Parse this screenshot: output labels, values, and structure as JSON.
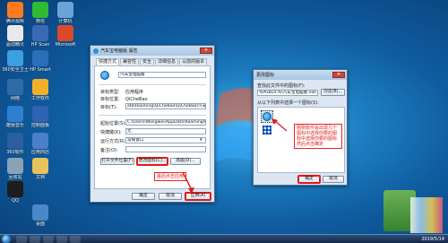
{
  "desktop_icons": [
    {
      "label": "腾讯视频",
      "color": "#ff7a1a"
    },
    {
      "label": "微信",
      "color": "#2dbb33"
    },
    {
      "label": "计算机",
      "color": "#6aa4d8"
    },
    {
      "label": "驱动精灵",
      "color": "#e9e9e9"
    },
    {
      "label": "HP Scan",
      "color": "#3a6ab6"
    },
    {
      "label": "Microsoft",
      "color": "#d94a2a"
    },
    {
      "label": "360安全卫士",
      "color": "#3aa0e0"
    },
    {
      "label": "HP Smart",
      "color": "#2a6fb8"
    },
    {
      "label": "网络",
      "color": "#2f6ba7"
    },
    {
      "label": "工作软件",
      "color": "#f0b02a"
    },
    {
      "label": "酷我音乐",
      "color": "#2f7fd0"
    },
    {
      "label": "控制面板",
      "color": "#2e62b3"
    },
    {
      "label": "360软件",
      "color": "#2a5fa0"
    },
    {
      "label": "应用商店",
      "color": "#4a80c8"
    },
    {
      "label": "回收站",
      "color": "#8aa2b8"
    },
    {
      "label": "文档",
      "color": "#e8c25a"
    },
    {
      "label": "QQ",
      "color": "#1d1d1d"
    },
    {
      "label": "桌面",
      "color": "#4b88c8"
    }
  ],
  "properties_window": {
    "title": "汽车宝电脑版 属性",
    "tabs": [
      "快捷方式",
      "兼容性",
      "安全",
      "详细信息",
      "以前的版本"
    ],
    "active_tab": 0,
    "app_name": "汽车宝电脑版",
    "target_type_label": "目标类型:",
    "target_type_value": "应用程序",
    "target_location_label": "目标位置:",
    "target_location_value": "QiCheBao",
    "target_label": "目标(T):",
    "target_value": "ata\\Roaming\\QiCheBao\\QiCheBao\\汽车宝电脑版.exe",
    "start_in_label": "起始位置(S):",
    "start_in_value": "C:\\Users\\Wangwei\\AppData\\Roaming\\QiCheBao",
    "shortcut_key_label": "快捷键(K):",
    "shortcut_key_value": "无",
    "run_label": "运行方式(R):",
    "run_value": "常规窗口",
    "comment_label": "备注(O):",
    "comment_value": "",
    "btn_open_location": "打开文件位置(F)",
    "btn_change_icon": "更改图标(C)...",
    "btn_advanced": "高级(D)...",
    "btn_ok": "确定",
    "btn_cancel": "取消",
    "btn_apply": "应用(A)",
    "callout": "最后点击应用"
  },
  "change_icon_window": {
    "title": "更改图标",
    "lookup_label": "查找此文件中的图标(F):",
    "path_value": "%PUBLIC%\\汽车宝电脑版.exe",
    "browse_btn": "浏览(B)...",
    "list_label": "从以下列表中选择一个图标(S):",
    "callout": "刚刚软件会出现几个图标中选择你要的图标中选择你要的图标然后点击确定",
    "btn_ok": "确定",
    "btn_cancel": "取消"
  },
  "taskbar": {
    "clock": "2019/5/14"
  },
  "colors": {
    "accent_red": "#e01818",
    "window_bg": "#dce7f3"
  }
}
